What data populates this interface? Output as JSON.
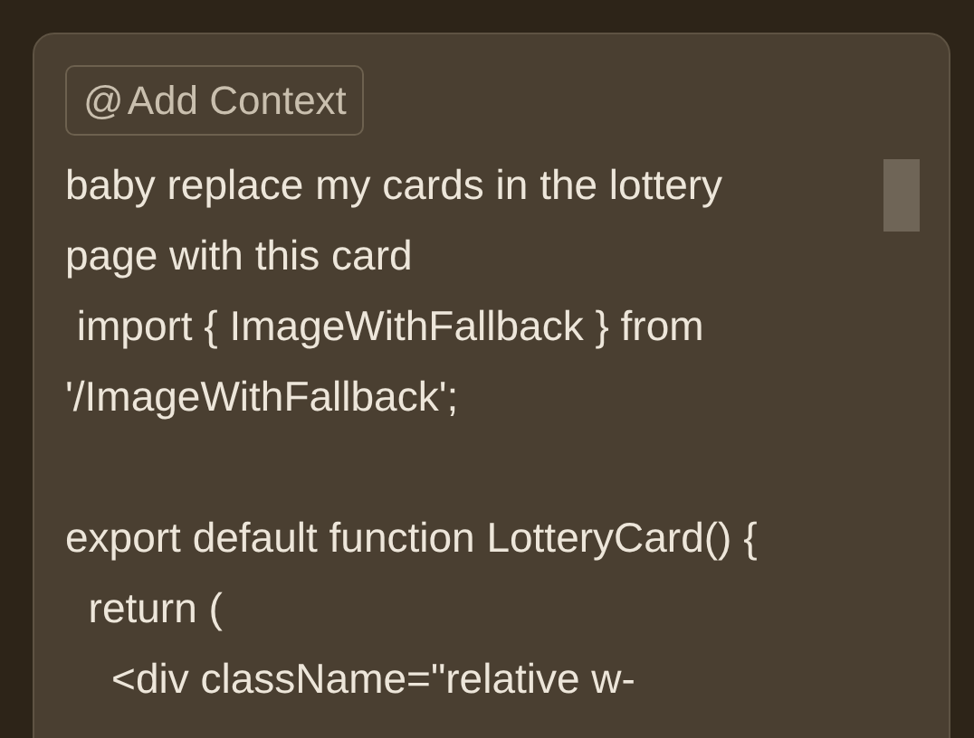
{
  "context_button": {
    "icon": "@",
    "label": "Add Context"
  },
  "message_blocks": [
    {
      "lines": [
        "baby replace my cards in the lottery",
        "page with this card",
        " import { ImageWithFallback } from",
        "'/ImageWithFallback';"
      ]
    },
    {
      "lines": [
        "export default function LotteryCard() {",
        "  return (",
        "    <div className=\"relative w-"
      ]
    }
  ]
}
